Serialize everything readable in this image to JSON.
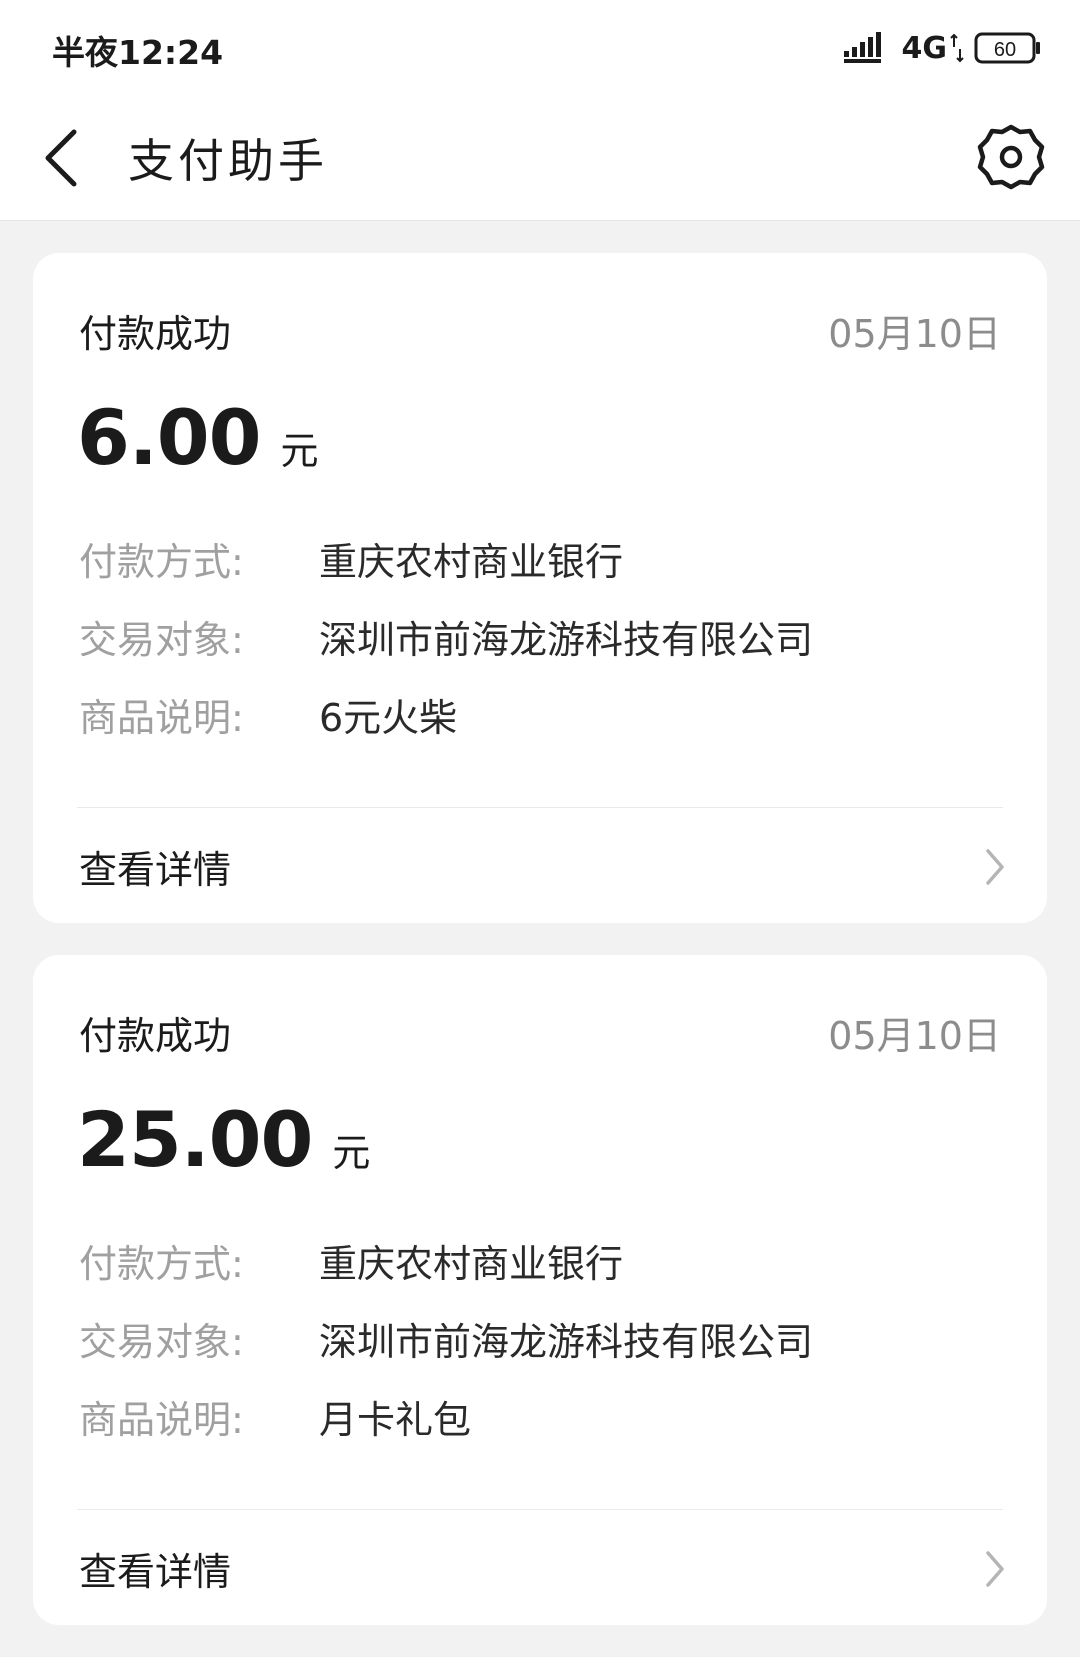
{
  "status_bar": {
    "time": "半夜12:24",
    "network": "4G",
    "battery": "60",
    "icons": [
      "signal-icon",
      "data-arrows-icon",
      "battery-icon"
    ]
  },
  "header": {
    "title": "支付助手",
    "icons": [
      "back-arrow-icon",
      "gear-icon"
    ]
  },
  "payments": [
    {
      "status": "付款成功",
      "date": "05月10日",
      "amount": "6.00",
      "unit": "元",
      "details": [
        {
          "label": "付款方式:",
          "value": "重庆农村商业银行"
        },
        {
          "label": "交易对象:",
          "value": "深圳市前海龙游科技有限公司"
        },
        {
          "label": "商品说明:",
          "value": "6元火柴"
        }
      ],
      "view_details": "查看详情"
    },
    {
      "status": "付款成功",
      "date": "05月10日",
      "amount": "25.00",
      "unit": "元",
      "details": [
        {
          "label": "付款方式:",
          "value": "重庆农村商业银行"
        },
        {
          "label": "交易对象:",
          "value": "深圳市前海龙游科技有限公司"
        },
        {
          "label": "商品说明:",
          "value": "月卡礼包"
        }
      ],
      "view_details": "查看详情"
    }
  ],
  "colors": {
    "background": "#f2f2f2",
    "card": "#ffffff",
    "primary_text": "#1b1b1b",
    "secondary_text": "#a0a0a0",
    "date_text": "#8c8c8c"
  }
}
